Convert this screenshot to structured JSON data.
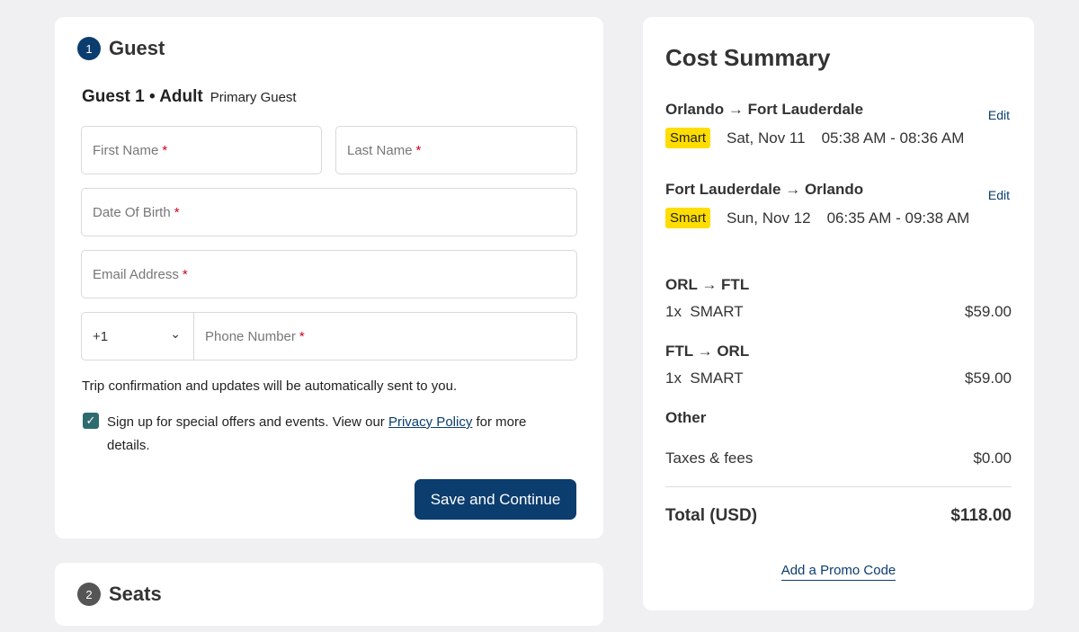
{
  "guest": {
    "step": "1",
    "title": "Guest",
    "heading": "Guest 1 • Adult",
    "sub": "Primary Guest",
    "fields": {
      "first": "First Name",
      "last": "Last Name",
      "dob": "Date Of Birth",
      "email": "Email Address",
      "code": "+1",
      "phone": "Phone Number"
    },
    "req": "*",
    "note": "Trip confirmation and updates will be automatically sent to you.",
    "offer_pre": "Sign up for special offers and events. View our ",
    "privacy": "Privacy Policy",
    "offer_post": " for more details.",
    "save": "Save and Continue"
  },
  "seats": {
    "step": "2",
    "title": "Seats"
  },
  "summary": {
    "title": "Cost Summary",
    "edit": "Edit",
    "flights": [
      {
        "from": "Orlando",
        "to": "Fort Lauderdale",
        "fare": "Smart",
        "date": "Sat, Nov 11",
        "time": "05:38 AM - 08:36 AM"
      },
      {
        "from": "Fort Lauderdale",
        "to": "Orlando",
        "fare": "Smart",
        "date": "Sun, Nov 12",
        "time": "06:35 AM - 09:38 AM"
      }
    ],
    "legs": [
      {
        "from": "ORL",
        "to": "FTL",
        "qty": "1x",
        "fare": "SMART",
        "price": "$59.00"
      },
      {
        "from": "FTL",
        "to": "ORL",
        "qty": "1x",
        "fare": "SMART",
        "price": "$59.00"
      }
    ],
    "other": "Other",
    "taxes": "Taxes & fees",
    "taxes_val": "$0.00",
    "total": "Total (USD)",
    "total_val": "$118.00",
    "promo": "Add a Promo Code"
  },
  "colors": {
    "brand": "#0b3d6e",
    "fare": "#ffdd00"
  }
}
